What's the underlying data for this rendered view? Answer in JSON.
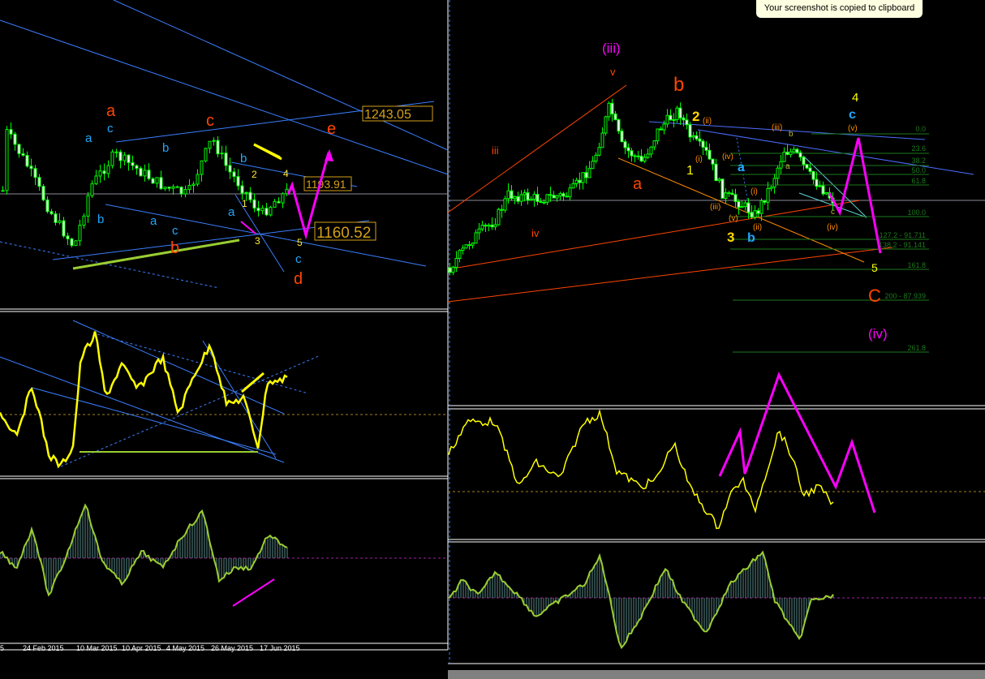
{
  "notification": {
    "text": "Your screenshot is copied to clipboard"
  },
  "left_chart": {
    "price_labels": {
      "upper": "1243.05",
      "mid": "1193.91",
      "target": "1160.52"
    },
    "waves": {
      "a_orange": "a",
      "c_orange": "c",
      "e_orange": "e",
      "b_orange": "b",
      "d_orange": "d",
      "a_blue1": "a",
      "c_blue1": "c",
      "b_blue1": "b",
      "b_blue2": "b",
      "a_blue2": "a",
      "c_blue2": "c",
      "b_blue3": "b",
      "a_blue3": "a",
      "c_blue3": "c",
      "n1": "1",
      "n2": "2",
      "n3": "3",
      "n4": "4",
      "n5": "5"
    },
    "time_axis": [
      "24 Feb 2015",
      "10 Mar 2015",
      "10 Apr 2015",
      "4 May 2015",
      "26 May 2015",
      "17 Jun 2015"
    ]
  },
  "right_chart": {
    "waves": {
      "iii_m": "(iii)",
      "v": "v",
      "iii": "iii",
      "iv": "iv",
      "b_big": "b",
      "a_big": "a",
      "n2": "2",
      "n1": "1",
      "n3": "3",
      "b_blue": "b",
      "a_blue": "a",
      "ii_p": "(ii)",
      "i_p": "(i)",
      "iv_p": "(iv)",
      "iii_p": "(iii)",
      "v_p": "(v)",
      "ii_p2": "(ii)",
      "i_p2": "(i)",
      "iii_p2": "(iii)",
      "iv_p2": "(iv)",
      "v_p2": "(v)",
      "small_b": "b",
      "small_a": "a",
      "small_c": "c",
      "n4": "4",
      "c_blue": "c",
      "n5": "5",
      "C_big": "C",
      "iv_m": "(iv)"
    },
    "fib_levels": [
      "0.0",
      "23.6",
      "38.2",
      "50.0",
      "61.8",
      "100.0",
      "127.2 - 91.711",
      "138.2 - 91.141",
      "161.8",
      "200 - 87.939",
      "261.8"
    ]
  },
  "colors": {
    "candle": "#00ff00",
    "blue_line": "#3a7fff",
    "orange": "#ff4500",
    "magenta": "#ff00ff",
    "yellow": "#ffff00",
    "fib": "#1c7a1c",
    "macd": "#9acd32"
  }
}
